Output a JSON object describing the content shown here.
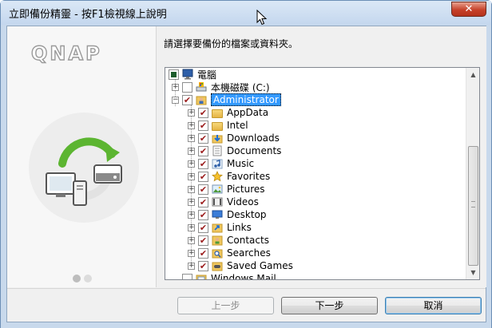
{
  "window": {
    "title": "立即備份精靈 - 按F1檢視線上說明",
    "close_label": "✕"
  },
  "brand": {
    "logo_text": "QNAP"
  },
  "pager": {
    "dots": 2,
    "active_index": 0
  },
  "main": {
    "prompt": "請選擇要備份的檔案或資料夾。"
  },
  "tree": {
    "root": {
      "label": "電腦",
      "expander": "−",
      "checked": "partial",
      "icon": "computer-icon"
    },
    "nodes": [
      {
        "label": "本機磁碟 (C:)",
        "expander": "+",
        "checked": "unchecked",
        "icon": "drive-icon"
      },
      {
        "label": "Administrator",
        "expander": "−",
        "checked": "checked",
        "icon": "user-folder-icon",
        "selected": true
      }
    ],
    "children": [
      {
        "label": "AppData",
        "checked": "checked",
        "icon": "folder-icon"
      },
      {
        "label": "Intel",
        "checked": "checked",
        "icon": "folder-icon"
      },
      {
        "label": "Downloads",
        "checked": "checked",
        "icon": "downloads-icon"
      },
      {
        "label": "Documents",
        "checked": "checked",
        "icon": "documents-icon"
      },
      {
        "label": "Music",
        "checked": "checked",
        "icon": "music-icon"
      },
      {
        "label": "Favorites",
        "checked": "checked",
        "icon": "favorites-icon"
      },
      {
        "label": "Pictures",
        "checked": "checked",
        "icon": "pictures-icon"
      },
      {
        "label": "Videos",
        "checked": "checked",
        "icon": "videos-icon"
      },
      {
        "label": "Desktop",
        "checked": "checked",
        "icon": "desktop-icon"
      },
      {
        "label": "Links",
        "checked": "checked",
        "icon": "links-icon"
      },
      {
        "label": "Contacts",
        "checked": "checked",
        "icon": "contacts-icon"
      },
      {
        "label": "Searches",
        "checked": "checked",
        "icon": "searches-icon"
      },
      {
        "label": "Saved Games",
        "checked": "checked",
        "icon": "saved-games-icon"
      }
    ],
    "tail": {
      "label": "Windows Mail",
      "checked": "unchecked",
      "icon": "mail-folder-icon"
    },
    "check_glyph": "✔"
  },
  "buttons": {
    "back": "上一步",
    "next": "下一步",
    "cancel": "取消"
  },
  "colors": {
    "frame": "#c8d9ec",
    "selection": "#3399ff",
    "check": "#9b1c1c",
    "close": "#c6412a",
    "arrow_green": "#5cb531"
  }
}
